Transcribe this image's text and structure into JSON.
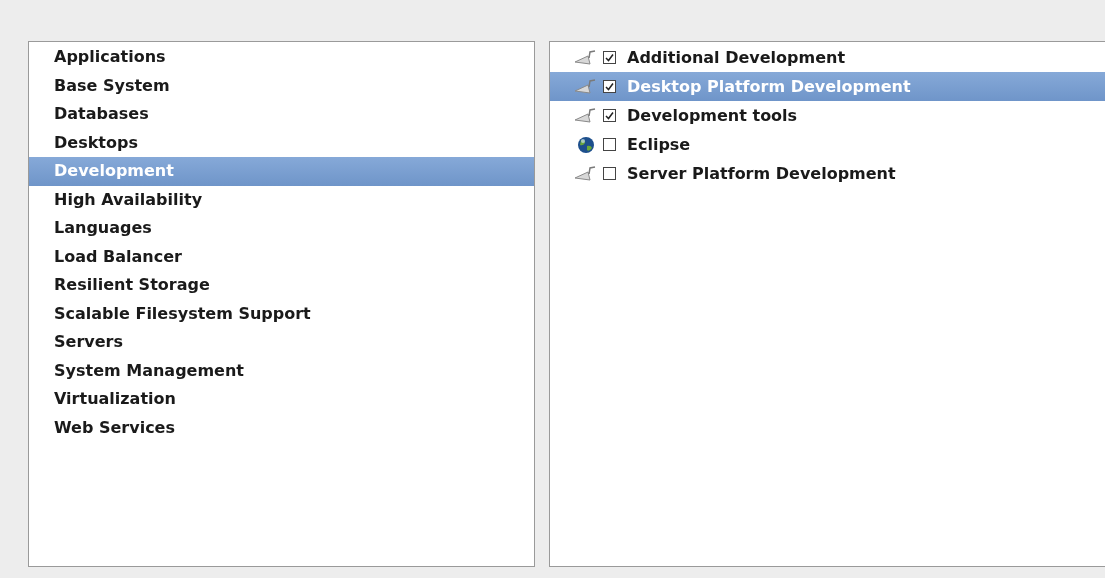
{
  "categories": [
    {
      "label": "Applications",
      "selected": false
    },
    {
      "label": "Base System",
      "selected": false
    },
    {
      "label": "Databases",
      "selected": false
    },
    {
      "label": "Desktops",
      "selected": false
    },
    {
      "label": "Development",
      "selected": true
    },
    {
      "label": "High Availability",
      "selected": false
    },
    {
      "label": "Languages",
      "selected": false
    },
    {
      "label": "Load Balancer",
      "selected": false
    },
    {
      "label": "Resilient Storage",
      "selected": false
    },
    {
      "label": "Scalable Filesystem Support",
      "selected": false
    },
    {
      "label": "Servers",
      "selected": false
    },
    {
      "label": "System Management",
      "selected": false
    },
    {
      "label": "Virtualization",
      "selected": false
    },
    {
      "label": "Web Services",
      "selected": false
    }
  ],
  "package_groups": [
    {
      "label": "Additional Development",
      "kind": "package",
      "checked": true,
      "selected": false
    },
    {
      "label": "Desktop Platform Development",
      "kind": "package",
      "checked": true,
      "selected": true
    },
    {
      "label": "Development tools",
      "kind": "package",
      "checked": true,
      "selected": false
    },
    {
      "label": "Eclipse",
      "kind": "globe",
      "checked": false,
      "selected": false
    },
    {
      "label": "Server Platform Development",
      "kind": "package",
      "checked": false,
      "selected": false
    }
  ]
}
